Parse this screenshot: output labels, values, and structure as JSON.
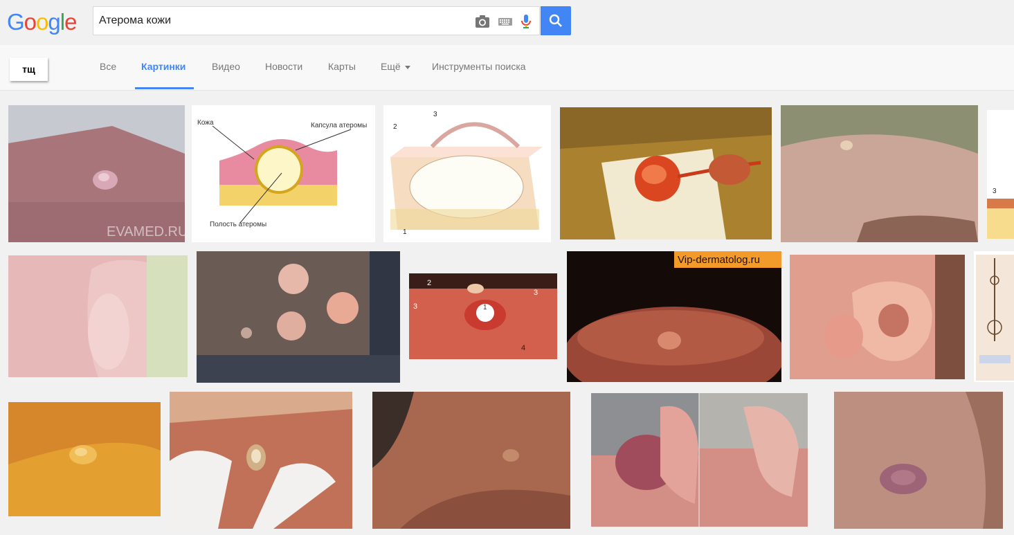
{
  "logo": {
    "letters": [
      "G",
      "o",
      "o",
      "g",
      "l",
      "e"
    ],
    "colors": [
      "#4285f4",
      "#ea4335",
      "#fbbc05",
      "#4285f4",
      "#34a853",
      "#ea4335"
    ]
  },
  "search": {
    "query": "Атерома кожи",
    "camera_icon": "camera-icon",
    "keyboard_icon": "keyboard-icon",
    "mic_icon": "mic-icon",
    "search_icon": "search-icon"
  },
  "overlay": {
    "label": "тщ"
  },
  "nav": {
    "tabs": [
      "Все",
      "Картинки",
      "Видео",
      "Новости",
      "Карты",
      "Ещё",
      "Инструменты поиска"
    ],
    "active_tab": "Картинки",
    "accent": "#4285f4"
  },
  "images": {
    "watermark_1": "EVAMED.RU",
    "diagram_labels": {
      "skin": "Кожа",
      "capsule": "Капсула атеромы",
      "cavity": "Полость атеромы"
    },
    "num_1": "1",
    "num_2": "2",
    "num_3": "3",
    "num_4": "4",
    "watermark_vip": "Vip-dermatolog.ru"
  }
}
